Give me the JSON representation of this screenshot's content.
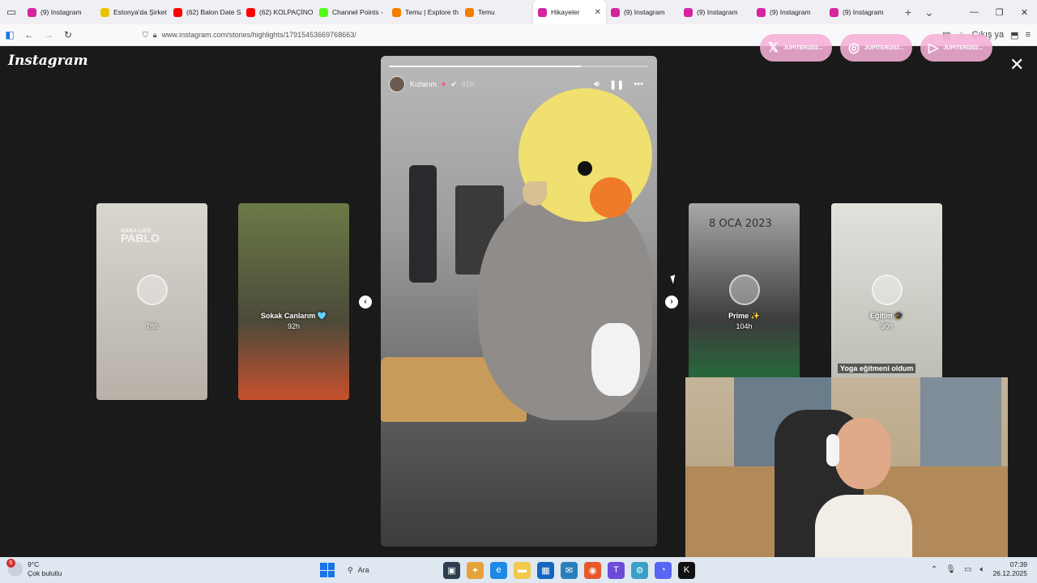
{
  "browser": {
    "tabs": [
      {
        "label": "(9) Instagram",
        "icon": "instagram-icon",
        "color": "#d6249f"
      },
      {
        "label": "Estonya'da Şirket",
        "icon": "bolt-icon",
        "color": "#e8c400"
      },
      {
        "label": "(62) Balon Date S",
        "icon": "youtube-icon",
        "color": "#ff0000"
      },
      {
        "label": "(62) KOLPAÇİNO",
        "icon": "youtube-icon",
        "color": "#ff0000"
      },
      {
        "label": "Channel Points -",
        "icon": "kick-icon",
        "color": "#53fc18"
      },
      {
        "label": "Temu | Explore th",
        "icon": "temu-icon",
        "color": "#f57c00"
      },
      {
        "label": "Temu",
        "icon": "temu-icon",
        "color": "#f57c00"
      },
      {
        "label": "Hikayeler",
        "icon": "instagram-icon",
        "color": "#d6249f",
        "active": true
      },
      {
        "label": "(9) Instagram",
        "icon": "instagram-icon",
        "color": "#d6249f"
      },
      {
        "label": "(9) Instagram",
        "icon": "instagram-icon",
        "color": "#d6249f"
      },
      {
        "label": "(9) Instagram",
        "icon": "instagram-icon",
        "color": "#d6249f"
      },
      {
        "label": "(9) Instagram",
        "icon": "instagram-icon",
        "color": "#d6249f"
      }
    ],
    "url": "www.instagram.com/stories/highlights/17915453669768663/",
    "partial_button": "Çıkış ya"
  },
  "instagram": {
    "logo": "Instagram",
    "overlay_pills": [
      {
        "label": "JUPITERI202...",
        "icon": "x-icon"
      },
      {
        "label": "JUPITERI202...",
        "icon": "instagram-icon"
      },
      {
        "label": "JUPITERI202...",
        "icon": "youtube-icon"
      }
    ],
    "thumbs": [
      {
        "name": "",
        "time": "78h",
        "watermark_top": "BABA LIKE",
        "watermark_big": "PABLO",
        "bg": "#c9c4bd"
      },
      {
        "name": "Sokak Canlarım 🩵",
        "time": "92h",
        "bg": "#5d6a3e"
      },
      {
        "name": "Prime ✨",
        "time": "104h",
        "date": "8 OCA 2023",
        "bg": "#7d7d7d"
      },
      {
        "name": "Eğitim 🎓",
        "time": "90h",
        "caption": "Yoga eğitmeni oldum",
        "bg": "#d6d6d2"
      }
    ],
    "story": {
      "username": "Kızlarım",
      "time": "91h",
      "progress": 0.74,
      "controls": {
        "sound": "sound-icon",
        "pause": "pause-icon",
        "more": "more-icon"
      }
    }
  },
  "taskbar": {
    "weather_temp": "9°C",
    "weather_desc": "Çok bulutlu",
    "weather_badge": "6",
    "search_placeholder": "Ara",
    "time": "07:39",
    "date": "26.12.2025"
  }
}
